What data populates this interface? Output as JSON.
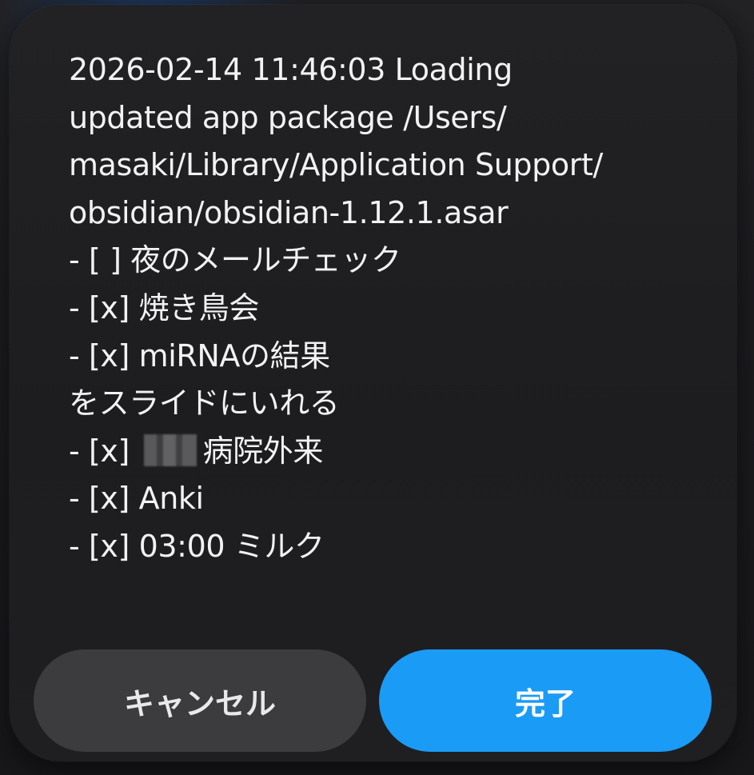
{
  "dialog": {
    "message_lines": [
      "2026-02-14 11:46:03 Loading",
      "updated app package /Users/",
      "masaki/Library/Application Support/",
      "obsidian/obsidian-1.12.1.asar",
      "- [ ] 夜のメールチェック",
      "- [x] 焼き鳥会",
      "- [x] miRNAの結果",
      "をスライドにいれる",
      "- [x] ",
      "- [x] Anki",
      "- [x] 03:00 ミルク"
    ],
    "redacted_line_suffix": "病院外来",
    "cancel_label": "キャンセル",
    "done_label": "完了"
  },
  "colors": {
    "sheet_background": "#1f1f21",
    "cancel_button": "#3c3c3f",
    "done_button": "#1a9bf6",
    "text": "#f2f2f4"
  }
}
